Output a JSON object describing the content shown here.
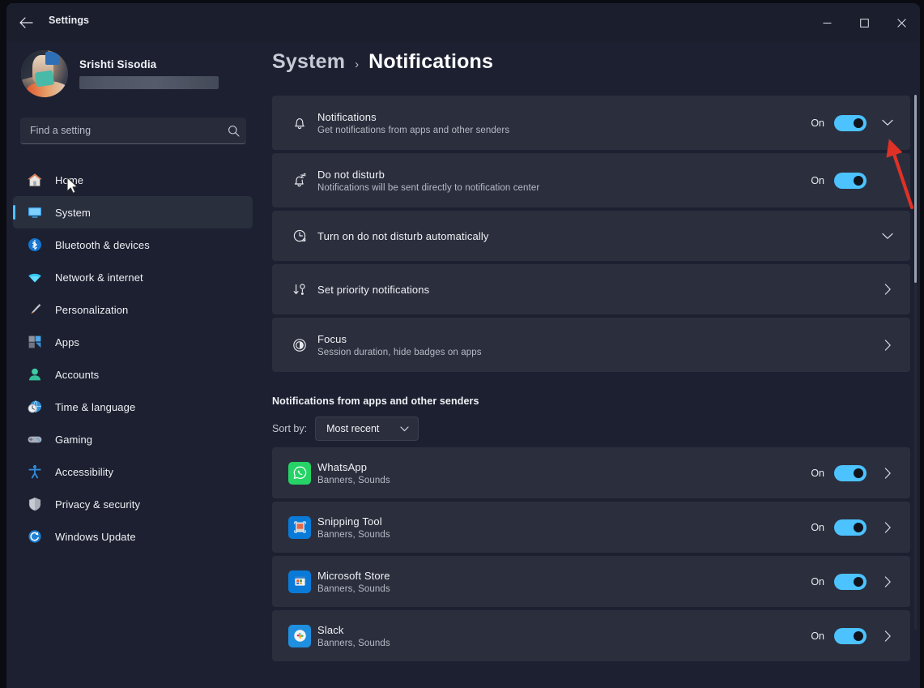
{
  "window": {
    "title": "Settings",
    "back_icon": "back-arrow-icon",
    "minimize": "minimize-icon",
    "maximize": "maximize-icon",
    "close": "close-icon"
  },
  "profile": {
    "name": "Srishti Sisodia",
    "email_redacted": ""
  },
  "search": {
    "placeholder": "Find a setting",
    "value": "",
    "icon": "search-icon"
  },
  "sidebar": {
    "items": [
      {
        "label": "Home",
        "icon": "home-icon",
        "active": false
      },
      {
        "label": "System",
        "icon": "system-icon",
        "active": true
      },
      {
        "label": "Bluetooth & devices",
        "icon": "bluetooth-icon",
        "active": false
      },
      {
        "label": "Network & internet",
        "icon": "network-icon",
        "active": false
      },
      {
        "label": "Personalization",
        "icon": "paintbrush-icon",
        "active": false
      },
      {
        "label": "Apps",
        "icon": "apps-icon",
        "active": false
      },
      {
        "label": "Accounts",
        "icon": "accounts-icon",
        "active": false
      },
      {
        "label": "Time & language",
        "icon": "clock-globe-icon",
        "active": false
      },
      {
        "label": "Gaming",
        "icon": "gamepad-icon",
        "active": false
      },
      {
        "label": "Accessibility",
        "icon": "accessibility-icon",
        "active": false
      },
      {
        "label": "Privacy & security",
        "icon": "shield-icon",
        "active": false
      },
      {
        "label": "Windows Update",
        "icon": "update-icon",
        "active": false
      }
    ]
  },
  "breadcrumb": {
    "parent": "System",
    "separator": "›",
    "current": "Notifications"
  },
  "settings_cards": [
    {
      "title": "Notifications",
      "subtitle": "Get notifications from apps and other senders",
      "icon": "bell-icon",
      "toggle_label": "On",
      "toggle_on": true,
      "expander": "chevron-down-icon"
    },
    {
      "title": "Do not disturb",
      "subtitle": "Notifications will be sent directly to notification center",
      "icon": "bell-sleep-icon",
      "toggle_label": "On",
      "toggle_on": true,
      "expander": null
    },
    {
      "title": "Turn on do not disturb automatically",
      "subtitle": "",
      "icon": "clock-icon",
      "toggle_label": null,
      "toggle_on": null,
      "expander": "chevron-down-icon"
    },
    {
      "title": "Set priority notifications",
      "subtitle": "",
      "icon": "priority-icon",
      "toggle_label": null,
      "toggle_on": null,
      "expander": "chevron-right-icon"
    },
    {
      "title": "Focus",
      "subtitle": "Session duration, hide badges on apps",
      "icon": "focus-icon",
      "toggle_label": null,
      "toggle_on": null,
      "expander": "chevron-right-icon"
    }
  ],
  "apps_section": {
    "heading": "Notifications from apps and other senders",
    "sort_label": "Sort by:",
    "sort_value": "Most recent",
    "sort_chevron": "chevron-down-icon",
    "apps": [
      {
        "name": "WhatsApp",
        "subtitle": "Banners, Sounds",
        "icon": "whatsapp-icon",
        "toggle_label": "On",
        "toggle_on": true,
        "expander": "chevron-right-icon"
      },
      {
        "name": "Snipping Tool",
        "subtitle": "Banners, Sounds",
        "icon": "snipping-tool-icon",
        "toggle_label": "On",
        "toggle_on": true,
        "expander": "chevron-right-icon"
      },
      {
        "name": "Microsoft Store",
        "subtitle": "Banners, Sounds",
        "icon": "microsoft-store-icon",
        "toggle_label": "On",
        "toggle_on": true,
        "expander": "chevron-right-icon"
      },
      {
        "name": "Slack",
        "subtitle": "Banners, Sounds",
        "icon": "slack-icon",
        "toggle_label": "On",
        "toggle_on": true,
        "expander": "chevron-right-icon"
      }
    ]
  },
  "annotation": {
    "type": "red-arrow",
    "color": "#e03127",
    "points_to": "notifications-card-expander"
  },
  "colors": {
    "accent": "#4cc2ff",
    "page_bg": "#1c2030",
    "card_bg": "#2b2f3d",
    "titlebar_bg": "#1b1f2d",
    "text_primary": "#f0f2f6",
    "text_secondary": "#b6bbc6"
  }
}
